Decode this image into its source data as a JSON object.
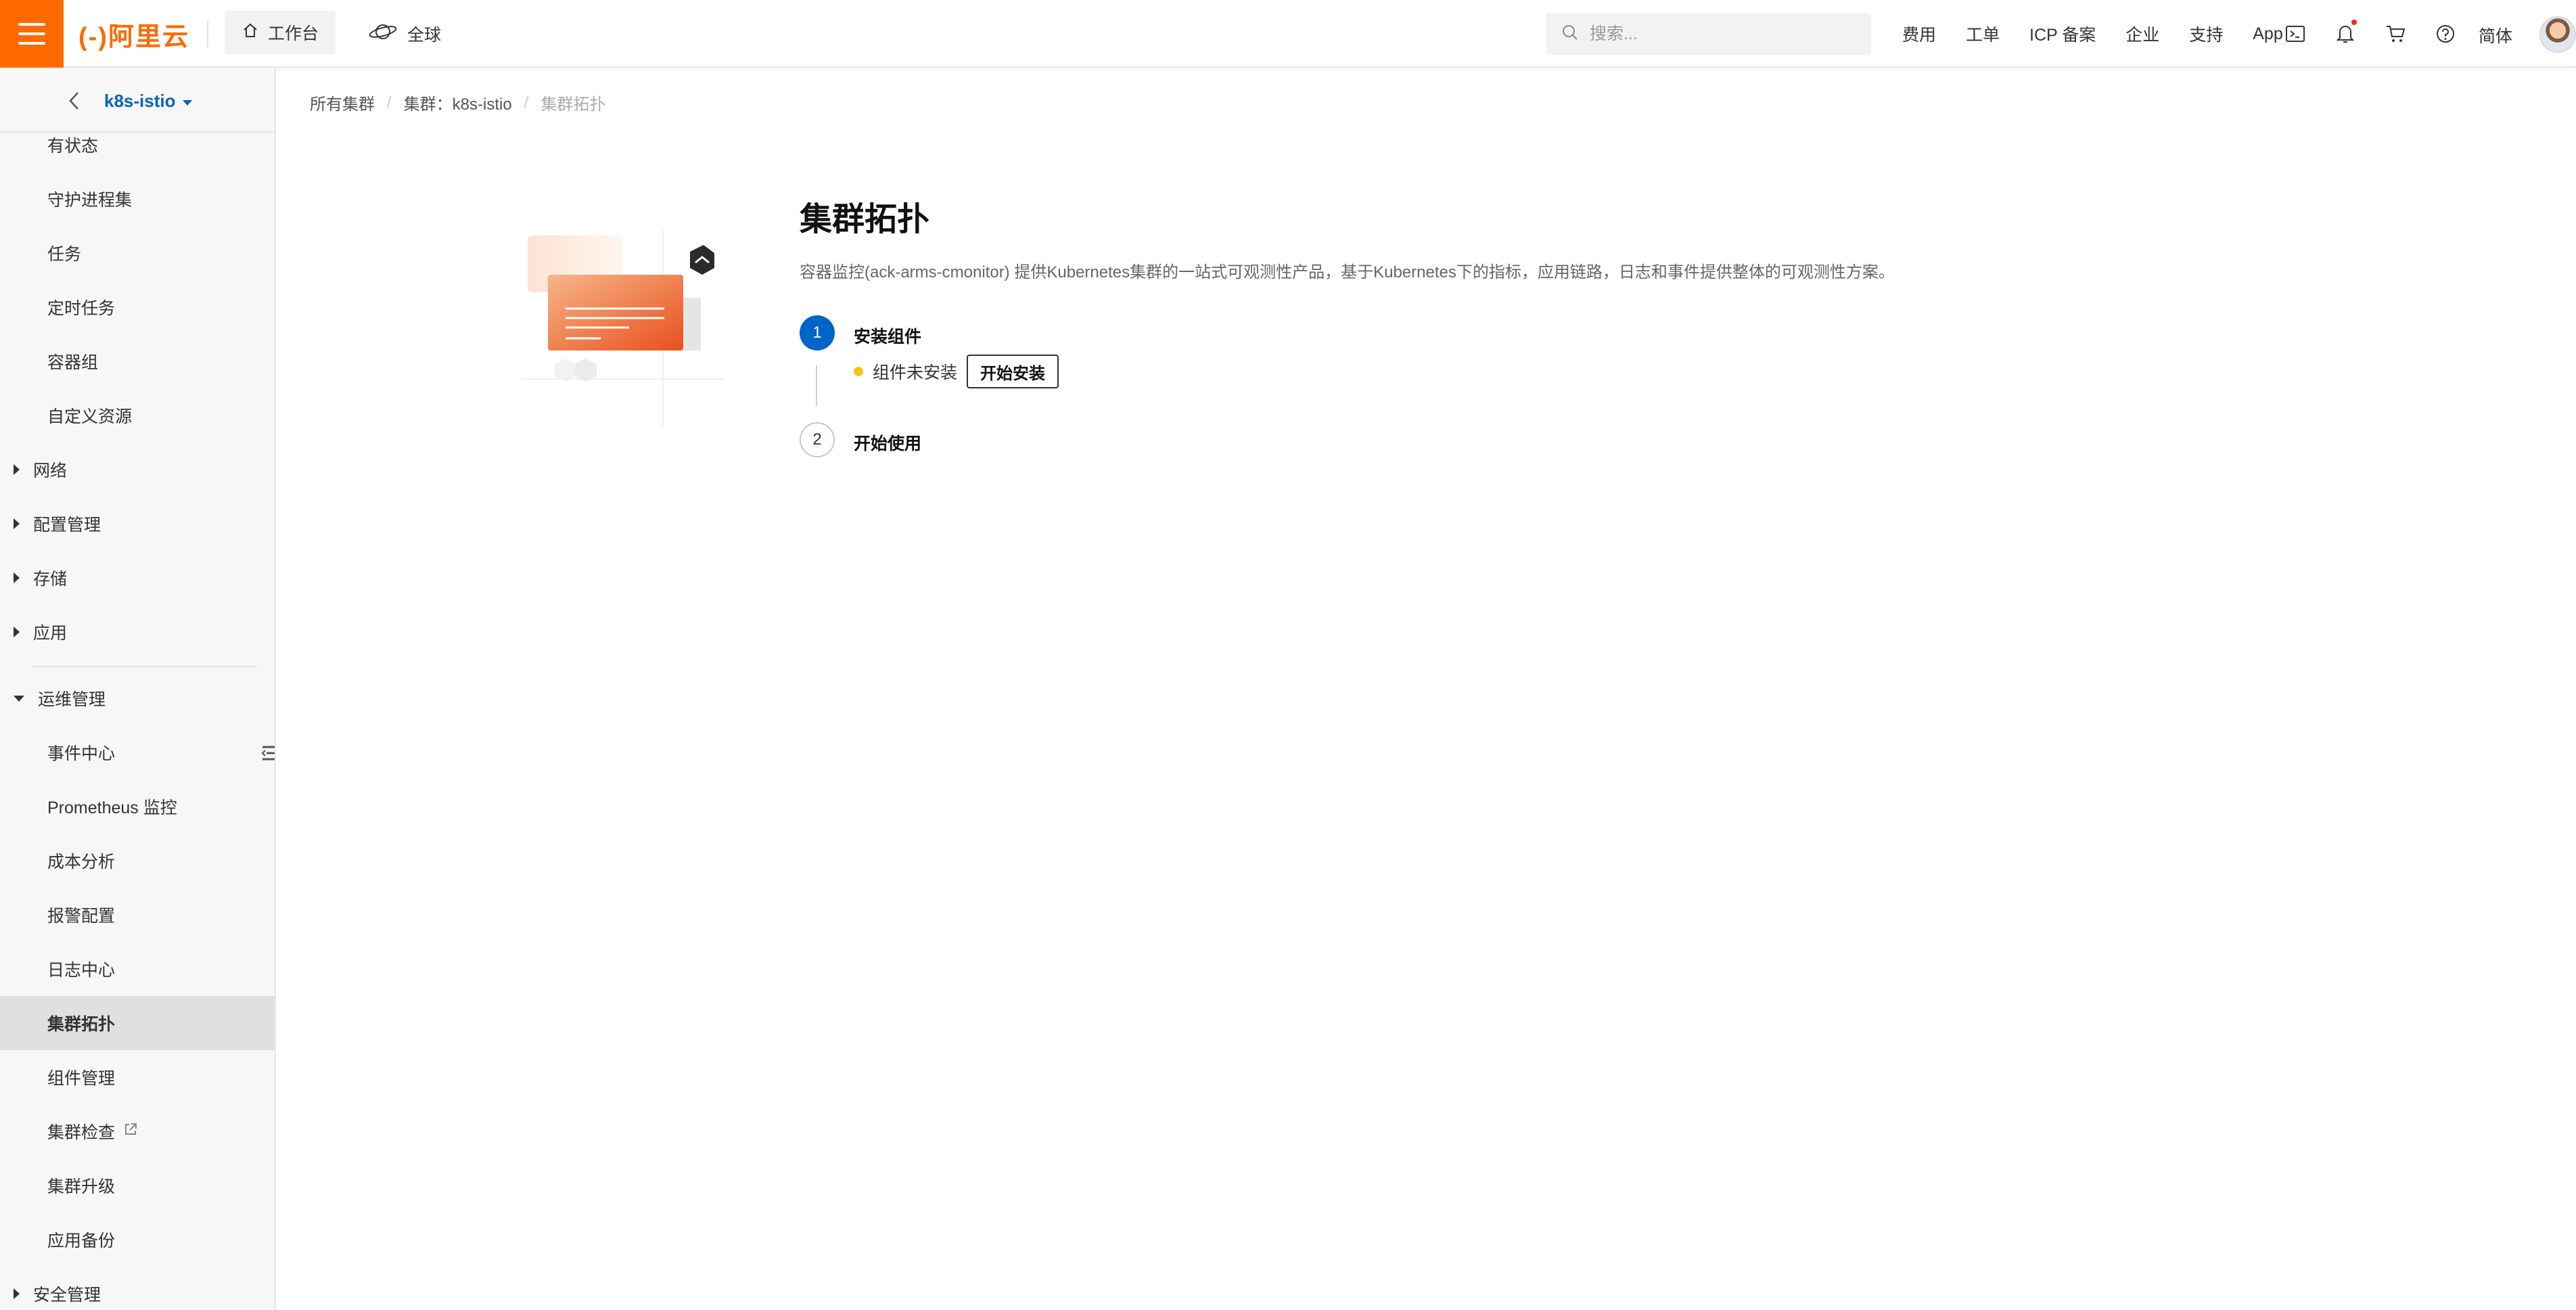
{
  "topbar": {
    "brand": "(-)阿里云",
    "workbench_label": "工作台",
    "region_label": "全球",
    "search_placeholder": "搜索...",
    "links": [
      "费用",
      "工单",
      "ICP 备案",
      "企业",
      "支持",
      "App"
    ],
    "language": "简体",
    "icons": [
      "terminal-icon",
      "bell-icon",
      "cart-icon",
      "help-icon"
    ],
    "accent_color": "#ff6a00"
  },
  "sidebar": {
    "cluster_name": "k8s-istio",
    "items": [
      {
        "label": "有状态",
        "kind": "sub"
      },
      {
        "label": "守护进程集",
        "kind": "sub"
      },
      {
        "label": "任务",
        "kind": "sub"
      },
      {
        "label": "定时任务",
        "kind": "sub"
      },
      {
        "label": "容器组",
        "kind": "sub"
      },
      {
        "label": "自定义资源",
        "kind": "sub"
      },
      {
        "label": "网络",
        "kind": "group",
        "expanded": false
      },
      {
        "label": "配置管理",
        "kind": "group",
        "expanded": false
      },
      {
        "label": "存储",
        "kind": "group",
        "expanded": false
      },
      {
        "label": "应用",
        "kind": "group",
        "expanded": false
      },
      {
        "label": "运维管理",
        "kind": "group",
        "expanded": true
      },
      {
        "label": "事件中心",
        "kind": "sub"
      },
      {
        "label": "Prometheus 监控",
        "kind": "sub"
      },
      {
        "label": "成本分析",
        "kind": "sub"
      },
      {
        "label": "报警配置",
        "kind": "sub"
      },
      {
        "label": "日志中心",
        "kind": "sub"
      },
      {
        "label": "集群拓扑",
        "kind": "sub",
        "active": true
      },
      {
        "label": "组件管理",
        "kind": "sub"
      },
      {
        "label": "集群检查",
        "kind": "sub",
        "external": true
      },
      {
        "label": "集群升级",
        "kind": "sub"
      },
      {
        "label": "应用备份",
        "kind": "sub"
      },
      {
        "label": "安全管理",
        "kind": "group",
        "expanded": false
      }
    ]
  },
  "breadcrumb": {
    "all_clusters": "所有集群",
    "cluster_prefix": "集群：",
    "cluster_name": "k8s-istio",
    "current": "集群拓扑"
  },
  "main": {
    "title": "集群拓扑",
    "description": "容器监控(ack-arms-cmonitor) 提供Kubernetes集群的一站式可观测性产品，基于Kubernetes下的指标，应用链路，日志和事件提供整体的可观测性方案。",
    "steps": [
      {
        "number": "1",
        "title": "安装组件",
        "status_text": "组件未安装",
        "status_color": "#fac31e",
        "action_label": "开始安装",
        "active": true
      },
      {
        "number": "2",
        "title": "开始使用",
        "active": false
      }
    ],
    "primary_color": "#0064c8"
  }
}
